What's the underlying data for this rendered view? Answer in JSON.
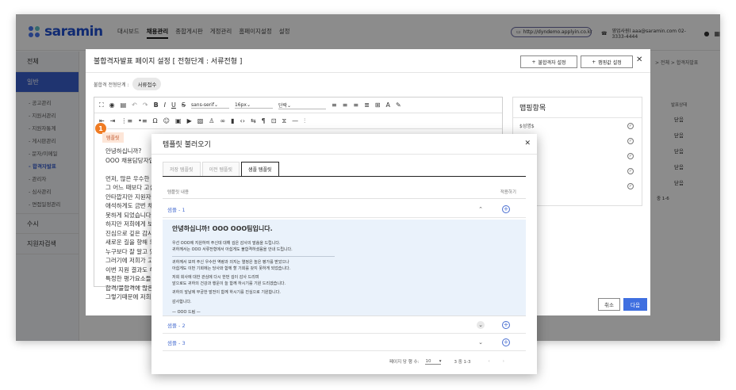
{
  "app": {
    "logo": "saramin",
    "nav": [
      "대시보드",
      "채용관리",
      "종합게시판",
      "게정관리",
      "홈페이지설정",
      "설정"
    ],
    "nav_active": "채용관리",
    "url": "http://dyndemo.applyin.co.kr",
    "contact": "영업사원l aaa@saramin.com 02-3333-4444"
  },
  "sidebar": {
    "top": "전체",
    "active": "일반",
    "subs": [
      "- 공고관리",
      "- 지원서관리",
      "- 지원자통계",
      "- 게시판관리",
      "- 문자/이메일",
      "- 합격자발표",
      "- 관리자",
      "- 심사관리",
      "- 면접일정관리"
    ],
    "sub_active": "- 합격자발표",
    "bottom1": "수시",
    "bottom2": "지원자검색"
  },
  "main": {
    "breadcrumb": "> 전체 > 합격자발표",
    "col_header": "발표상태",
    "rows": [
      "닫음",
      "닫음",
      "닫음",
      "닫음",
      "닫음"
    ],
    "pagination": "중 1-6"
  },
  "modal1": {
    "title": "불합격자발표 페이지 설정 [ 전형단계 : 서류전형 ]",
    "btn_preview": "불합격자 설정",
    "btn_mapping": "맵핑값 설정",
    "stage_label": "불합격 전형단계 :",
    "stage_chip": "서류접수",
    "font_family": "sans-serif",
    "font_size": "16px",
    "paragraph": "단락",
    "tag_badge": "템플릿",
    "step_number": "1",
    "editor_text": "안녕하십니까?\nOOO 채용담당자입\n\n먼저, 많은 우수한 지\n그 어느 때보다 고심\n안타깝지만 지원자\n애석하게도 금번 채\n못하게 되었습니다.\n하지만 저희에게 보\n진심으로 깊은 감사\n새로운 길을 향해 도\n누구보다 잘 알고 있\n그러기에 저희가 고\n이번 지원 결과도 해\n특정한 평가요소들에\n합격/불합격에 많은\n그렇기때문에 저희",
    "mapping_title": "맵핑항목",
    "mapping_rows": [
      "$성명$",
      "",
      "",
      "",
      ""
    ],
    "btn_cancel": "취소",
    "btn_next": "다음"
  },
  "modal2": {
    "title": "템플릿 불러오기",
    "tabs": [
      "저장 템플릿",
      "이전 템플릿",
      "샘플 템플릿"
    ],
    "active_tab": "샘플 템플릿",
    "col_content": "템플릿 내용",
    "col_load": "적용하기",
    "samples": [
      "샘플 - 1",
      "샘플 - 2",
      "샘플 - 3"
    ],
    "sample1_title": "안녕하십니까! OOO OOO팀입니다.",
    "sample1_p1": "우선 OOO에 지원하여 주신데 대해 깊은 감사의 말씀을 드립니다.\n귀하께서는 OOO 서류전형에서 아쉽게도 불합격하셨음을 안내 드립니다.",
    "sample1_p2": "귀하께서 보여 주신 우수한 역량과 의지는 열정은 높은 평가를 받았으나\n아쉽게도 이번 기회에는 당사와 함께 할 기회를 갖지 못하게 되었습니다.",
    "sample1_p3": "저희 회사에 대한 관심에 다시 한번 깊이 감사 드리며\n앞으로도 귀하의 건강과 행운이 늘 함께 하시기를 기원 드리겠습니다.",
    "sample1_p4": "귀하의 앞날에 무궁한 발전이 함께 하시기를 진심으로 기원합니다.",
    "sample1_p5": "감사합니다.",
    "sample1_p6": "— OOO 드림 —",
    "per_page_label": "페이지 당 행 수:",
    "per_page": "10",
    "range": "3 중 1-3"
  }
}
